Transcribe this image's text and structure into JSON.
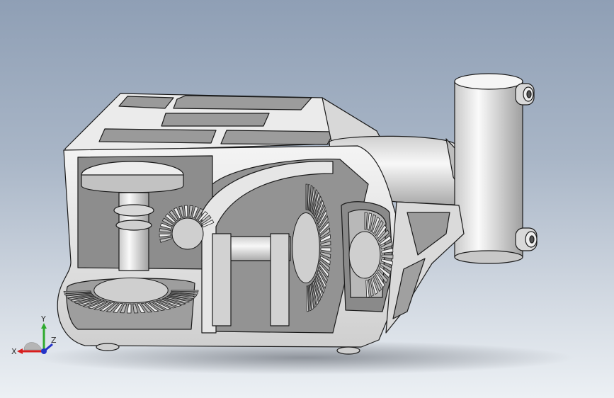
{
  "viewport": {
    "background_top": "#8f9fb5",
    "background_bottom": "#ecf0f4"
  },
  "model": {
    "body_color": "#e3e3e3",
    "shade_color": "#b9b9b9",
    "dark_color": "#6e6e6e",
    "edge_color": "#1a1a1a"
  },
  "triad": {
    "x_label": "X",
    "y_label": "Y",
    "z_label": "Z",
    "x_color": "#d81d1d",
    "y_color": "#2eaa2e",
    "z_color": "#2534c8"
  }
}
